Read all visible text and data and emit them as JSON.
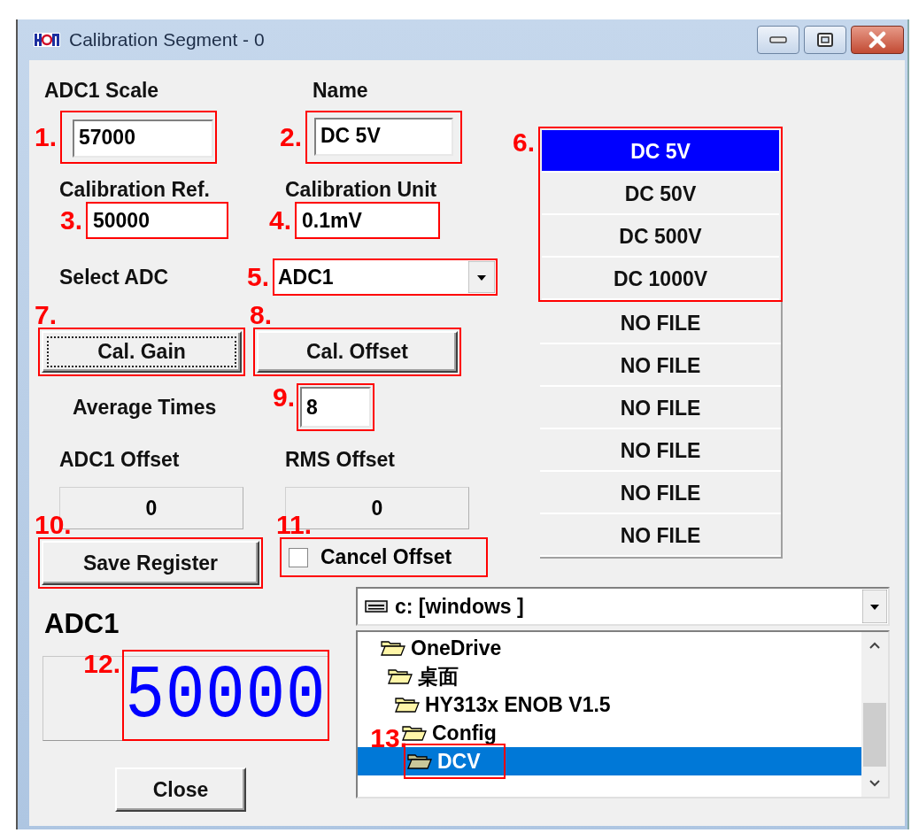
{
  "window": {
    "title": "Calibration Segment - 0"
  },
  "adc_scale": {
    "label": "ADC1 Scale",
    "value": "57000",
    "callout": "1."
  },
  "name": {
    "label": "Name",
    "value": "DC 5V",
    "callout": "2."
  },
  "calibration_ref": {
    "label": "Calibration Ref.",
    "value": "50000",
    "callout": "3."
  },
  "calibration_unit": {
    "label": "Calibration Unit",
    "value": "0.1mV",
    "callout": "4."
  },
  "select_adc": {
    "label": "Select ADC",
    "value": "ADC1",
    "callout": "5."
  },
  "segment_list": {
    "callout": "6.",
    "items": [
      {
        "label": "DC 5V",
        "selected": true,
        "outlined": true
      },
      {
        "label": "DC 50V",
        "selected": false,
        "outlined": true
      },
      {
        "label": "DC 500V",
        "selected": false,
        "outlined": true
      },
      {
        "label": "DC 1000V",
        "selected": false,
        "outlined": true
      },
      {
        "label": "NO FILE",
        "selected": false,
        "outlined": false
      },
      {
        "label": "NO FILE",
        "selected": false,
        "outlined": false
      },
      {
        "label": "NO FILE",
        "selected": false,
        "outlined": false
      },
      {
        "label": "NO FILE",
        "selected": false,
        "outlined": false
      },
      {
        "label": "NO FILE",
        "selected": false,
        "outlined": false
      },
      {
        "label": "NO FILE",
        "selected": false,
        "outlined": false
      }
    ]
  },
  "cal_gain": {
    "label": "Cal. Gain",
    "focused": true,
    "callout": "7."
  },
  "cal_offset": {
    "label": "Cal. Offset",
    "focused": false,
    "callout": "8."
  },
  "average_times": {
    "label": "Average Times",
    "value": "8",
    "callout": "9."
  },
  "adc_offset": {
    "label": "ADC1 Offset",
    "value": "0"
  },
  "rms_offset": {
    "label": "RMS Offset",
    "value": "0"
  },
  "save_register": {
    "label": "Save Register",
    "callout": "10."
  },
  "cancel_offset": {
    "label": "Cancel Offset",
    "checked": false,
    "callout": "11."
  },
  "display": {
    "title": "ADC1",
    "reading": "50000",
    "callout": "12."
  },
  "close_button": {
    "label": "Close"
  },
  "drive": {
    "value": "c: [windows ]"
  },
  "folders": [
    {
      "label": "OneDrive",
      "selected": false,
      "children": [
        {
          "label": "桌面",
          "selected": false,
          "children": [
            {
              "label": "HY313x ENOB V1.5",
              "selected": false,
              "children": [
                {
                  "label": "Config",
                  "selected": false,
                  "children": [
                    {
                      "label": "DCV",
                      "selected": true,
                      "callout": "13."
                    }
                  ]
                }
              ]
            }
          ]
        }
      ]
    }
  ]
}
